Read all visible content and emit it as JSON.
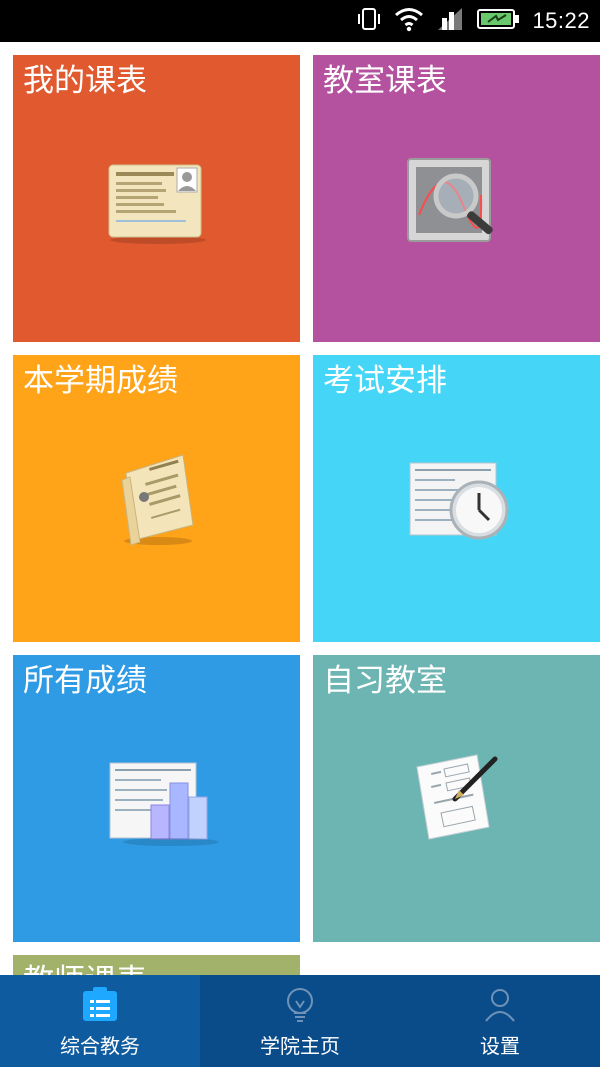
{
  "status": {
    "time": "15:22",
    "icons": [
      "vibrate-icon",
      "wifi-icon",
      "signal-icon",
      "battery-icon"
    ]
  },
  "tiles": [
    {
      "label": "我的课表",
      "icon": "student-card-icon",
      "color": "#e15a2f"
    },
    {
      "label": "教室课表",
      "icon": "magnifier-chart-icon",
      "color": "#b4529f"
    },
    {
      "label": "本学期成绩",
      "icon": "document-file-icon",
      "color": "#ffa318"
    },
    {
      "label": "考试安排",
      "icon": "clock-document-icon",
      "color": "#45d6f7"
    },
    {
      "label": "所有成绩",
      "icon": "bar-chart-document-icon",
      "color": "#2f9be4"
    },
    {
      "label": "自习教室",
      "icon": "pen-form-icon",
      "color": "#6cb5b3"
    },
    {
      "label": "教师课表",
      "icon": "teacher-schedule-icon",
      "color": "#a3b26b"
    }
  ],
  "nav": [
    {
      "label": "综合教务",
      "icon": "list-clipboard-icon",
      "active": true
    },
    {
      "label": "学院主页",
      "icon": "lightbulb-icon",
      "active": false
    },
    {
      "label": "设置",
      "icon": "person-icon",
      "active": false
    }
  ]
}
